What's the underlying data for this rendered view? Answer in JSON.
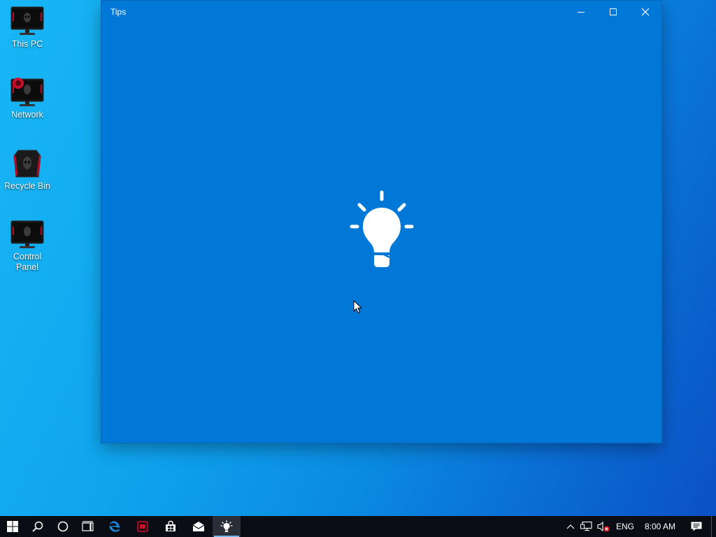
{
  "desktop": {
    "icons": [
      {
        "label": "This PC"
      },
      {
        "label": "Network"
      },
      {
        "label": "Recycle Bin"
      },
      {
        "label": "Control Panel"
      }
    ]
  },
  "window": {
    "title": "Tips",
    "app_icon": "lightbulb-icon",
    "accent": "#0078d7"
  },
  "taskbar": {
    "items": [
      "start-icon",
      "search-icon",
      "cortana-icon",
      "task-view-icon",
      "edge-icon",
      "game-app-icon",
      "store-icon",
      "mail-icon",
      "tips-icon"
    ],
    "active": "tips-icon",
    "tray": {
      "language": "ENG",
      "time": "8:00 AM"
    }
  }
}
